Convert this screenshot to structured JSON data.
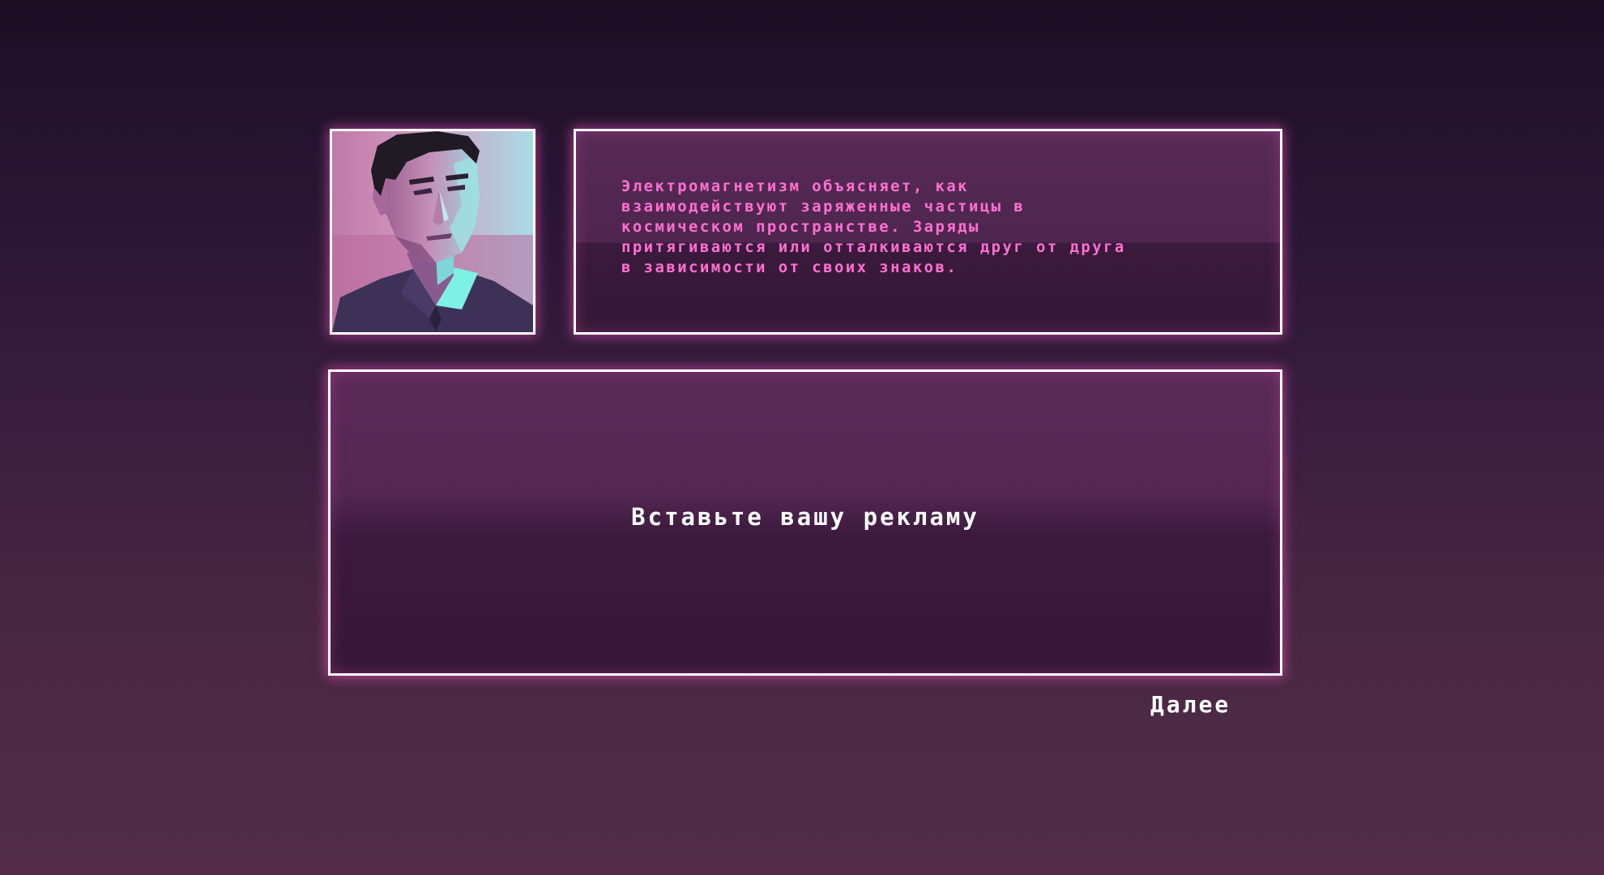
{
  "character": {
    "portrait": "character-portrait-man"
  },
  "dialog": {
    "text": "Электромагнетизм объясняет, как\nвзаимодействуют заряженные частицы в\nкосмическом пространстве. Заряды\nпритягиваются или отталкиваются друг от друга\nв зависимости от своих знаков."
  },
  "ad": {
    "label": "Вставьте вашу рекламу"
  },
  "controls": {
    "next_label": "Далее"
  },
  "colors": {
    "accent_pink": "#ff6fd0",
    "border": "#ffffff",
    "background_top": "#1d0e24",
    "background_bottom": "#522c48"
  }
}
